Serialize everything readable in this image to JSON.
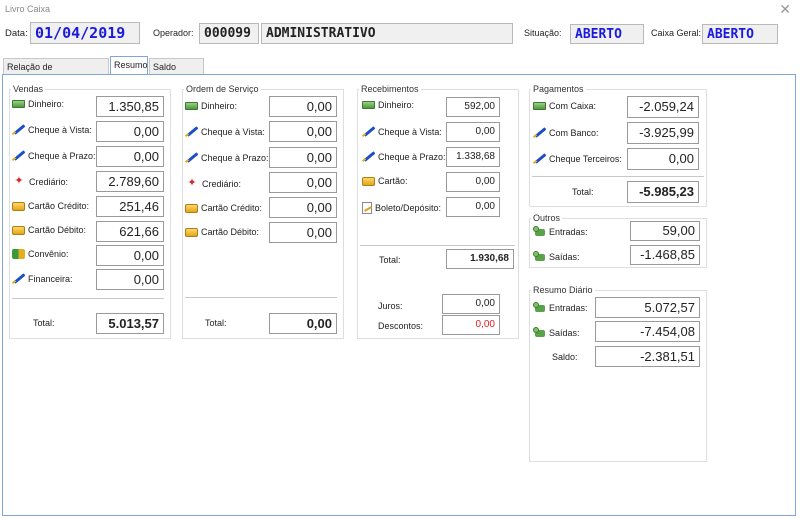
{
  "window": {
    "title": "Livro Caixa"
  },
  "header": {
    "data_label": "Data:",
    "data_value": "01/04/2019",
    "operador_label": "Operador:",
    "operador_code": "000099",
    "operador_name": "ADMINISTRATIVO",
    "situacao_label": "Situação:",
    "situacao_value": "ABERTO",
    "caixa_geral_label": "Caixa Geral:",
    "caixa_geral_value": "ABERTO"
  },
  "tabs": [
    {
      "label": "Relação de Lançamentos"
    },
    {
      "label": "Resumo"
    },
    {
      "label": "Saldo Caixas"
    }
  ],
  "vendas": {
    "title": "Vendas",
    "rows": [
      {
        "label": "Dinheiro:",
        "value": "1.350,85"
      },
      {
        "label": "Cheque à Vista:",
        "value": "0,00"
      },
      {
        "label": "Cheque à Prazo:",
        "value": "0,00"
      },
      {
        "label": "Crediário:",
        "value": "2.789,60"
      },
      {
        "label": "Cartão Crédito:",
        "value": "251,46"
      },
      {
        "label": "Cartão Débito:",
        "value": "621,66"
      },
      {
        "label": "Convênio:",
        "value": "0,00"
      },
      {
        "label": "Financeira:",
        "value": "0,00"
      }
    ],
    "total_label": "Total:",
    "total_value": "5.013,57"
  },
  "ordem_servico": {
    "title": "Ordem de Serviço",
    "rows": [
      {
        "label": "Dinheiro:",
        "value": "0,00"
      },
      {
        "label": "Cheque à Vista:",
        "value": "0,00"
      },
      {
        "label": "Cheque à Prazo:",
        "value": "0,00"
      },
      {
        "label": "Crediário:",
        "value": "0,00"
      },
      {
        "label": "Cartão Crédito:",
        "value": "0,00"
      },
      {
        "label": "Cartão Débito:",
        "value": "0,00"
      }
    ],
    "total_label": "Total:",
    "total_value": "0,00"
  },
  "recebimentos": {
    "title": "Recebimentos",
    "rows": [
      {
        "label": "Dinheiro:",
        "value": "592,00"
      },
      {
        "label": "Cheque à Vista:",
        "value": "0,00"
      },
      {
        "label": "Cheque à Prazo:",
        "value": "1.338,68"
      },
      {
        "label": "Cartão:",
        "value": "0,00"
      },
      {
        "label": "Boleto/Depósito:",
        "value": "0,00"
      }
    ],
    "total_label": "Total:",
    "total_value": "1.930,68",
    "juros_label": "Juros:",
    "juros_value": "0,00",
    "descontos_label": "Descontos:",
    "descontos_value": "0,00"
  },
  "pagamentos": {
    "title": "Pagamentos",
    "rows": [
      {
        "label": "Com Caixa:",
        "value": "-2.059,24"
      },
      {
        "label": "Com Banco:",
        "value": "-3.925,99"
      },
      {
        "label": "Cheque Terceiros:",
        "value": "0,00"
      }
    ],
    "total_label": "Total:",
    "total_value": "-5.985,23"
  },
  "outros": {
    "title": "Outros",
    "entradas_label": "Entradas:",
    "entradas_value": "59,00",
    "saidas_label": "Saídas:",
    "saidas_value": "-1.468,85"
  },
  "resumo_diario": {
    "title": "Resumo Diário",
    "entradas_label": "Entradas:",
    "entradas_value": "5.072,57",
    "saidas_label": "Saídas:",
    "saidas_value": "-7.454,08",
    "saldo_label": "Saldo:",
    "saldo_value": "-2.381,51"
  },
  "colors": {
    "blue_text": "#1a1adc",
    "red_text": "#e02020",
    "tab_border": "#7ea6d6"
  }
}
